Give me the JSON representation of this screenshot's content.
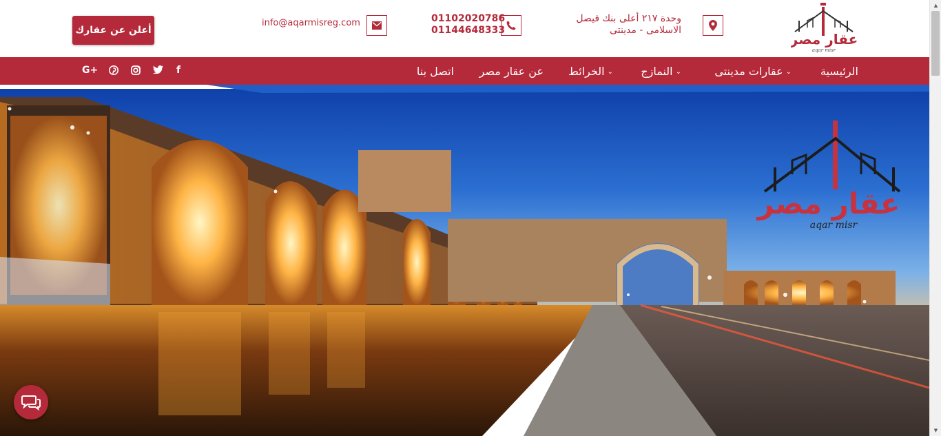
{
  "header": {
    "logo_text": "عقار مصر",
    "logo_subtext": "aqar misr",
    "address_line1": "وحدة ٢١٧ أعلى بنك فيصل",
    "address_line2": "الاسلامى - مدينتى",
    "phone1": "01102020786",
    "phone2": "01144648333",
    "email": "info@aqarmisreg.com",
    "cta_label": "أعلن عن عقارك"
  },
  "nav": {
    "items": [
      {
        "label": "الرئيسية",
        "dropdown": false
      },
      {
        "label": "عقارات مدينتى",
        "dropdown": true
      },
      {
        "label": "النمازج",
        "dropdown": true
      },
      {
        "label": "الخرائط",
        "dropdown": true
      },
      {
        "label": "عن عقار مصر",
        "dropdown": false
      },
      {
        "label": "اتصل بنا",
        "dropdown": false
      }
    ],
    "social": [
      {
        "icon": "facebook-icon",
        "glyph": "f"
      },
      {
        "icon": "twitter-icon",
        "glyph": ""
      },
      {
        "icon": "instagram-icon",
        "glyph": ""
      },
      {
        "icon": "pinterest-icon",
        "glyph": ""
      },
      {
        "icon": "google-plus-icon",
        "glyph": "G+"
      }
    ]
  },
  "hero": {
    "logo_text": "عقار مصر",
    "logo_subtext": "aqar misr"
  },
  "colors": {
    "brand": "#b52a3a",
    "nav_bg": "#b52a3a"
  }
}
